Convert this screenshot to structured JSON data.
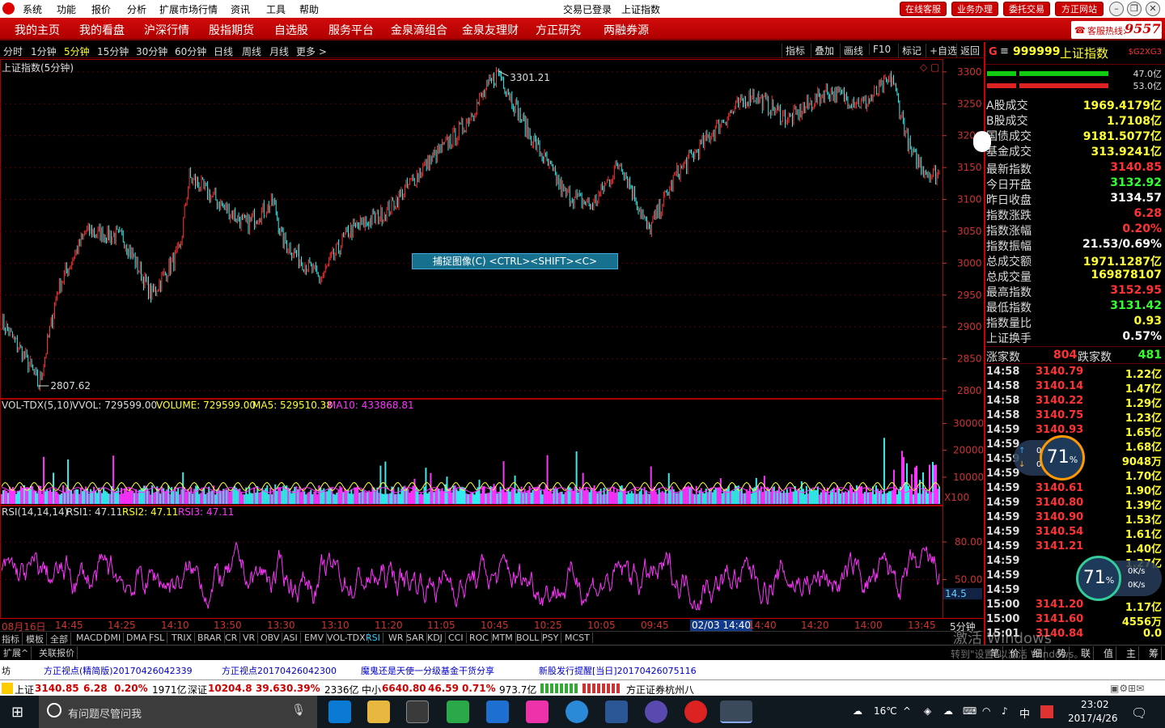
{
  "menubar": {
    "items": [
      "系统",
      "功能",
      "报价",
      "分析",
      "扩展市场行情",
      "资讯",
      "工具",
      "帮助"
    ],
    "center": [
      "交易已登录",
      "上证指数"
    ],
    "services": [
      "在线客服",
      "业务办理",
      "委托交易",
      "方正网站"
    ]
  },
  "navbar": {
    "items": [
      "我的主页",
      "我的看盘",
      "沪深行情",
      "股指期货",
      "自选股",
      "服务平台",
      "金泉滴组合",
      "金泉友理财",
      "方正研究",
      "两融券源"
    ],
    "hotline_label": "客服热线:",
    "hotline_num": "95571"
  },
  "periodbar": {
    "periods": [
      "分时",
      "1分钟",
      "5分钟",
      "15分钟",
      "30分钟",
      "60分钟",
      "日线",
      "周线",
      "月线",
      "更多 >"
    ],
    "active": "5分钟",
    "tools": [
      "指标",
      "叠加",
      "画线",
      "F10",
      "标记",
      "+自选",
      "返回"
    ]
  },
  "mainchart": {
    "title": "上证指数(5分钟)",
    "high_label": "3301.21",
    "low_label": "2807.62",
    "y_ticks": [
      "3300",
      "3250",
      "3200",
      "3150",
      "3100",
      "3050",
      "3000",
      "2950",
      "2900",
      "2850",
      "2800"
    ],
    "capture_tip": "捕捉图像(C)    <CTRL><SHIFT><C>"
  },
  "volchart": {
    "name": "VOL-TDX(5,10)",
    "vvol": "VVOL: 729599.00",
    "volume": "VOLUME: 729599.00",
    "ma5": "MA5: 529510.38",
    "ma10": "MA10: 433868.81",
    "y_ticks": [
      "30000",
      "20000",
      "10000"
    ],
    "unit": "X100"
  },
  "rsichart": {
    "name": "RSI(14,14,14)",
    "rsi1": "RSI1: 47.11",
    "rsi2": "RSI2: 47.11",
    "rsi3": "RSI3: 47.11",
    "y_ticks": [
      "80.00",
      "50.00"
    ],
    "marker": "14.5"
  },
  "timeaxis": {
    "labels": [
      "08月16日",
      "14:45",
      "14:25",
      "14:10",
      "13:50",
      "13:30",
      "13:10",
      "11:20",
      "11:05",
      "10:45",
      "10:25",
      "10:05",
      "09:45",
      "02/03 14:40",
      "14:40",
      "14:20",
      "14:00",
      "13:45"
    ],
    "period": "5分钟"
  },
  "indtabs": {
    "items": [
      "指标",
      "模板",
      "全部",
      "MACD",
      "DMI",
      "DMA",
      "FSL",
      "TRIX",
      "BRAR",
      "CR",
      "VR",
      "OBV",
      "ASI",
      "EMV",
      "VOL-TDX",
      "RSI",
      "WR",
      "SAR",
      "KDJ",
      "CCI",
      "ROC",
      "MTM",
      "BOLL",
      "PSY",
      "MCST"
    ],
    "active": "RSI"
  },
  "exttabs": {
    "items": [
      "扩展^",
      "关联报价"
    ],
    "right_items": [
      "笔",
      "价",
      "细",
      "势",
      "联",
      "值",
      "主",
      "筹"
    ]
  },
  "rightpanel": {
    "code": "999999",
    "name": "上证指数",
    "tag": "$G2XG3",
    "up_pct": "47.0亿",
    "down_pct": "53.0亿",
    "stats": [
      {
        "label": "A股成交",
        "value": "1969.4179亿",
        "color": "#ffff33"
      },
      {
        "label": "B股成交",
        "value": "1.7108亿",
        "color": "#ffff33"
      },
      {
        "label": "国债成交",
        "value": "9181.5077亿",
        "color": "#ffff33"
      },
      {
        "label": "基金成交",
        "value": "313.9241亿",
        "color": "#ffff33"
      }
    ],
    "quote": [
      {
        "label": "最新指数",
        "value": "3140.85",
        "color": "#ff3333"
      },
      {
        "label": "今日开盘",
        "value": "3132.92",
        "color": "#33ff33"
      },
      {
        "label": "昨日收盘",
        "value": "3134.57",
        "color": "#ffffff"
      },
      {
        "label": "指数涨跌",
        "value": "6.28",
        "color": "#ff3333"
      },
      {
        "label": "指数涨幅",
        "value": "0.20%",
        "color": "#ff3333"
      },
      {
        "label": "指数振幅",
        "value": "21.53/0.69%",
        "color": "#ffffff"
      },
      {
        "label": "总成交额",
        "value": "1971.1287亿",
        "color": "#ffff33"
      },
      {
        "label": "总成交量",
        "value": "169878107",
        "color": "#ffff33"
      },
      {
        "label": "最高指数",
        "value": "3152.95",
        "color": "#ff3333"
      },
      {
        "label": "最低指数",
        "value": "3131.42",
        "color": "#33ff33"
      },
      {
        "label": "指数量比",
        "value": "0.93",
        "color": "#ffff33"
      },
      {
        "label": "上证换手",
        "value": "0.57%",
        "color": "#ffffff"
      }
    ],
    "rise_label": "涨家数",
    "rise": "804",
    "fall_label": "跌家数",
    "fall": "481",
    "ticks": [
      {
        "t": "14:58",
        "p": "3140.79",
        "a": "1.22亿"
      },
      {
        "t": "14:58",
        "p": "3140.14",
        "a": "1.47亿"
      },
      {
        "t": "14:58",
        "p": "3140.22",
        "a": "1.29亿"
      },
      {
        "t": "14:58",
        "p": "3140.75",
        "a": "1.23亿"
      },
      {
        "t": "14:59",
        "p": "3140.93",
        "a": "1.65亿"
      },
      {
        "t": "14:59",
        "p": "",
        "a": "1.68亿"
      },
      {
        "t": "14:59",
        "p": "",
        "a": "9048万"
      },
      {
        "t": "14:59",
        "p": "",
        "a": "1.70亿"
      },
      {
        "t": "14:59",
        "p": "3140.61",
        "a": "1.90亿"
      },
      {
        "t": "14:59",
        "p": "3140.80",
        "a": "1.39亿"
      },
      {
        "t": "14:59",
        "p": "3140.90",
        "a": "1.53亿"
      },
      {
        "t": "14:59",
        "p": "3140.54",
        "a": "1.61亿"
      },
      {
        "t": "14:59",
        "p": "3141.21",
        "a": "1.40亿"
      },
      {
        "t": "14:59",
        "p": "",
        "a": "1.27亿"
      },
      {
        "t": "14:59",
        "p": "",
        "a": ""
      },
      {
        "t": "14:59",
        "p": "",
        "a": ""
      },
      {
        "t": "15:00",
        "p": "3141.20",
        "a": "1.17亿"
      },
      {
        "t": "15:00",
        "p": "3141.60",
        "a": "4556万"
      },
      {
        "t": "15:01",
        "p": "3140.84",
        "a": "0.0"
      }
    ]
  },
  "widgets": {
    "w1": {
      "pct": "71",
      "unit": "%",
      "up": "0K/s",
      "down": "0K/s"
    },
    "w2": {
      "pct": "71",
      "unit": "%",
      "up": "0K/s",
      "down": "0K/s"
    }
  },
  "watermark": {
    "line1": "激活 Windows",
    "line2": "转到\"设置\"以激活 Windows。"
  },
  "newsbar": {
    "items": [
      "坊",
      "方正视点(精简版)20170426042339",
      "方正视点20170426042300",
      "魔鬼还是天使一分级基金干货分享",
      "新股发行提醒[当日]20170426075116"
    ]
  },
  "statusbar": {
    "sh_label": "上证",
    "sh_val": "3140.85",
    "sh_chg": "6.28",
    "sh_pct": "0.20%",
    "sh_amt": "1971亿",
    "sz_label": "深证",
    "sz_val": "10204.8",
    "sz_chg": "39.63",
    "sz_pct": "0.39%",
    "sz_amt": "2336亿",
    "zx_label": "中小",
    "zx_val": "6640.80",
    "zx_chg": "46.59",
    "zx_pct": "0.71%",
    "zx_amt": "973.7亿",
    "broker": "方正证券杭州八"
  },
  "taskbar": {
    "search_placeholder": "有问题尽管问我",
    "weather": "16℃",
    "ime": "中",
    "time": "23:02",
    "date": "2017/4/26"
  },
  "chart_data": {
    "type": "candlestick-line",
    "title": "上证指数(5分钟)",
    "ylim": [
      2800,
      3310
    ],
    "y_ticks": [
      3300,
      3250,
      3200,
      3150,
      3100,
      3050,
      3000,
      2950,
      2900,
      2850,
      2800
    ],
    "high": 3301.21,
    "low": 2807.62,
    "x_labels": [
      "08月16日",
      "14:45",
      "14:25",
      "14:10",
      "13:50",
      "13:30",
      "13:10",
      "11:20",
      "11:05",
      "10:45",
      "10:25",
      "10:05",
      "09:45",
      "02/03 14:40",
      "14:40",
      "14:20",
      "14:00",
      "13:45"
    ],
    "key_points": [
      {
        "x": 0,
        "y": 2910
      },
      {
        "x": 0.03,
        "y": 2840
      },
      {
        "x": 0.04,
        "y": 2808
      },
      {
        "x": 0.06,
        "y": 2960
      },
      {
        "x": 0.09,
        "y": 3050
      },
      {
        "x": 0.13,
        "y": 3040
      },
      {
        "x": 0.16,
        "y": 2950
      },
      {
        "x": 0.19,
        "y": 3020
      },
      {
        "x": 0.2,
        "y": 3135
      },
      {
        "x": 0.26,
        "y": 3060
      },
      {
        "x": 0.29,
        "y": 3095
      },
      {
        "x": 0.3,
        "y": 3035
      },
      {
        "x": 0.34,
        "y": 2975
      },
      {
        "x": 0.37,
        "y": 3050
      },
      {
        "x": 0.41,
        "y": 3080
      },
      {
        "x": 0.45,
        "y": 3150
      },
      {
        "x": 0.49,
        "y": 3210
      },
      {
        "x": 0.53,
        "y": 3301
      },
      {
        "x": 0.56,
        "y": 3210
      },
      {
        "x": 0.6,
        "y": 3110
      },
      {
        "x": 0.63,
        "y": 3090
      },
      {
        "x": 0.66,
        "y": 3160
      },
      {
        "x": 0.69,
        "y": 3050
      },
      {
        "x": 0.72,
        "y": 3140
      },
      {
        "x": 0.77,
        "y": 3225
      },
      {
        "x": 0.8,
        "y": 3265
      },
      {
        "x": 0.84,
        "y": 3225
      },
      {
        "x": 0.88,
        "y": 3270
      },
      {
        "x": 0.92,
        "y": 3250
      },
      {
        "x": 0.95,
        "y": 3290
      },
      {
        "x": 0.97,
        "y": 3170
      },
      {
        "x": 0.99,
        "y": 3140
      }
    ],
    "vol_ylim": [
      0,
      35000
    ],
    "vol_y_ticks": [
      30000,
      20000,
      10000
    ],
    "rsi_ylim": [
      20,
      100
    ],
    "rsi_y_ticks": [
      80,
      50
    ]
  }
}
